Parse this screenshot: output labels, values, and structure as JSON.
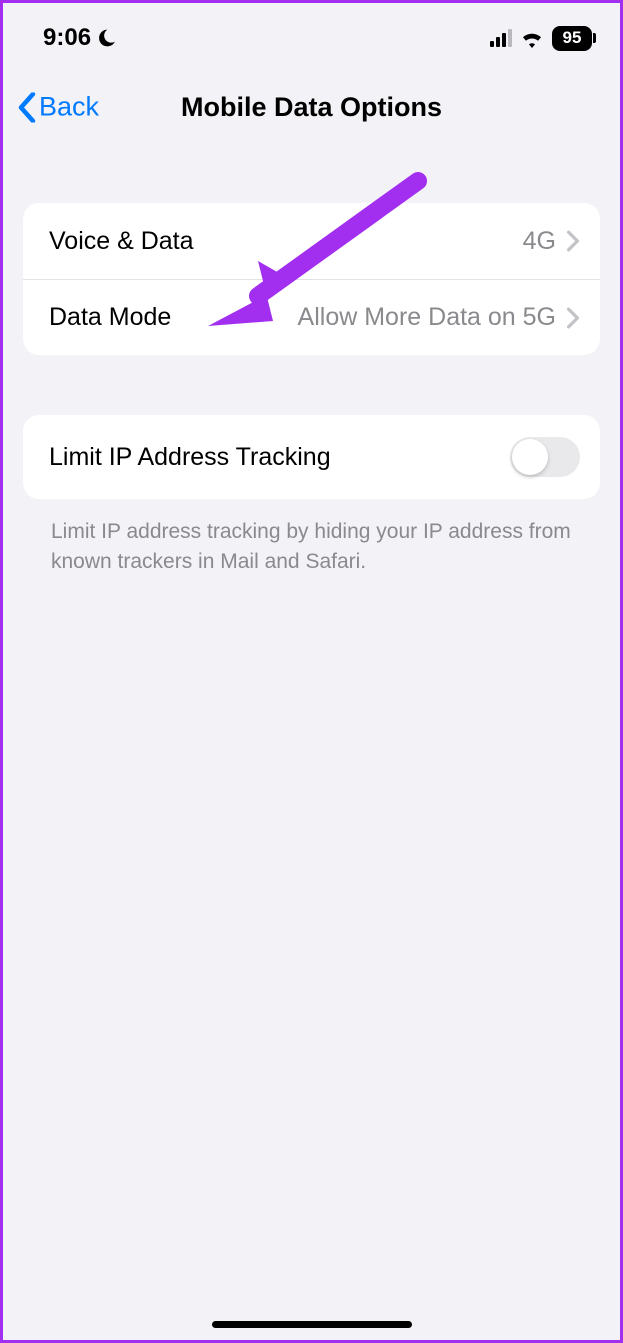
{
  "status": {
    "time": "9:06",
    "battery": "95"
  },
  "nav": {
    "back_label": "Back",
    "title": "Mobile Data Options"
  },
  "rows": {
    "voice_data": {
      "label": "Voice & Data",
      "value": "4G"
    },
    "data_mode": {
      "label": "Data Mode",
      "value": "Allow More Data on 5G"
    },
    "limit_ip": {
      "label": "Limit IP Address Tracking",
      "on": false
    }
  },
  "footer": "Limit IP address tracking by hiding your IP address from known trackers in Mail and Safari.",
  "annotation": {
    "arrow_color": "#a22ff0"
  }
}
